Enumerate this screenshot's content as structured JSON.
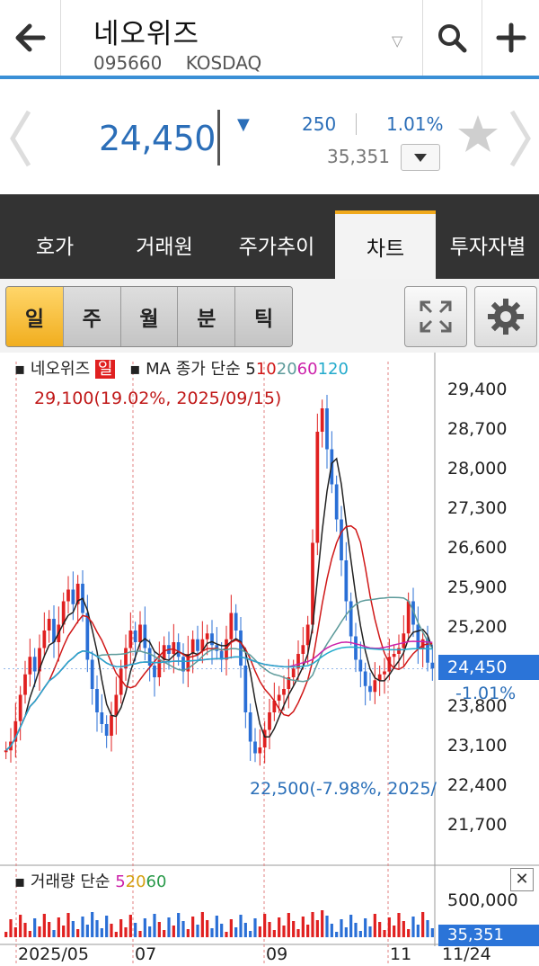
{
  "header": {
    "stock_name": "네오위즈",
    "stock_code": "095660",
    "market": "KOSDAQ"
  },
  "quote": {
    "price": "24,450",
    "change": "250",
    "change_pct": "1.01%",
    "volume": "35,351",
    "direction": "down",
    "color_down": "#2b6eb8"
  },
  "tabs": [
    "호가",
    "거래원",
    "주가추이",
    "차트",
    "투자자별"
  ],
  "active_tab": "차트",
  "periods": [
    "일",
    "주",
    "월",
    "분",
    "틱"
  ],
  "active_period": "일",
  "chart_data": {
    "type": "candlestick",
    "legend": {
      "name": "네오위즈",
      "badge": "일",
      "ma_label": "MA 종가 단순",
      "ma_periods": [
        "5",
        "10",
        "20",
        "60",
        "120"
      ],
      "ma_colors": [
        "#222222",
        "#d01818",
        "#5c9a9a",
        "#cc22aa",
        "#22aacc"
      ]
    },
    "y_ticks": [
      "29,400",
      "28,700",
      "28,000",
      "27,300",
      "26,600",
      "25,900",
      "25,200",
      "23,800",
      "23,100",
      "22,400",
      "21,700"
    ],
    "y_range": [
      21300,
      29700
    ],
    "x_labels": [
      "2025/05",
      "07",
      "09",
      "11",
      "11/24"
    ],
    "high_annotation": "29,100(19.02%, 2025/09/15)",
    "low_annotation": "22,500(-7.98%, 2025/",
    "current_price": "24,450",
    "current_pct": "-1.01%",
    "close_series": [
      23050,
      23200,
      23550,
      24000,
      24350,
      24650,
      24400,
      24800,
      25100,
      25300,
      24900,
      25200,
      25600,
      25800,
      25550,
      25900,
      25400,
      24600,
      24100,
      23700,
      23500,
      23300,
      23650,
      24000,
      24450,
      24800,
      25100,
      24900,
      25200,
      24800,
      24500,
      24300,
      24600,
      24850,
      24700,
      24900,
      24650,
      24400,
      24700,
      24950,
      24750,
      24950,
      25050,
      24850,
      24750,
      24600,
      24950,
      25400,
      25100,
      24500,
      23700,
      23200,
      23000,
      23100,
      23400,
      23700,
      23900,
      24000,
      24100,
      24300,
      24450,
      24700,
      24850,
      25200,
      26600,
      28500,
      28900,
      28200,
      27600,
      27000,
      26300,
      25600,
      25000,
      24600,
      24400,
      24150,
      24050,
      24250,
      24350,
      24400,
      24650,
      24700,
      24800,
      25050,
      25600,
      25200,
      24800,
      24950,
      24550,
      24450
    ],
    "volume_legend": {
      "label": "거래량 단순",
      "periods": [
        "5",
        "20",
        "60"
      ],
      "colors": [
        "#cc22aa",
        "#d4a010",
        "#2a9a4a"
      ]
    },
    "volume_axis": "500,000",
    "current_volume": "35,351"
  }
}
